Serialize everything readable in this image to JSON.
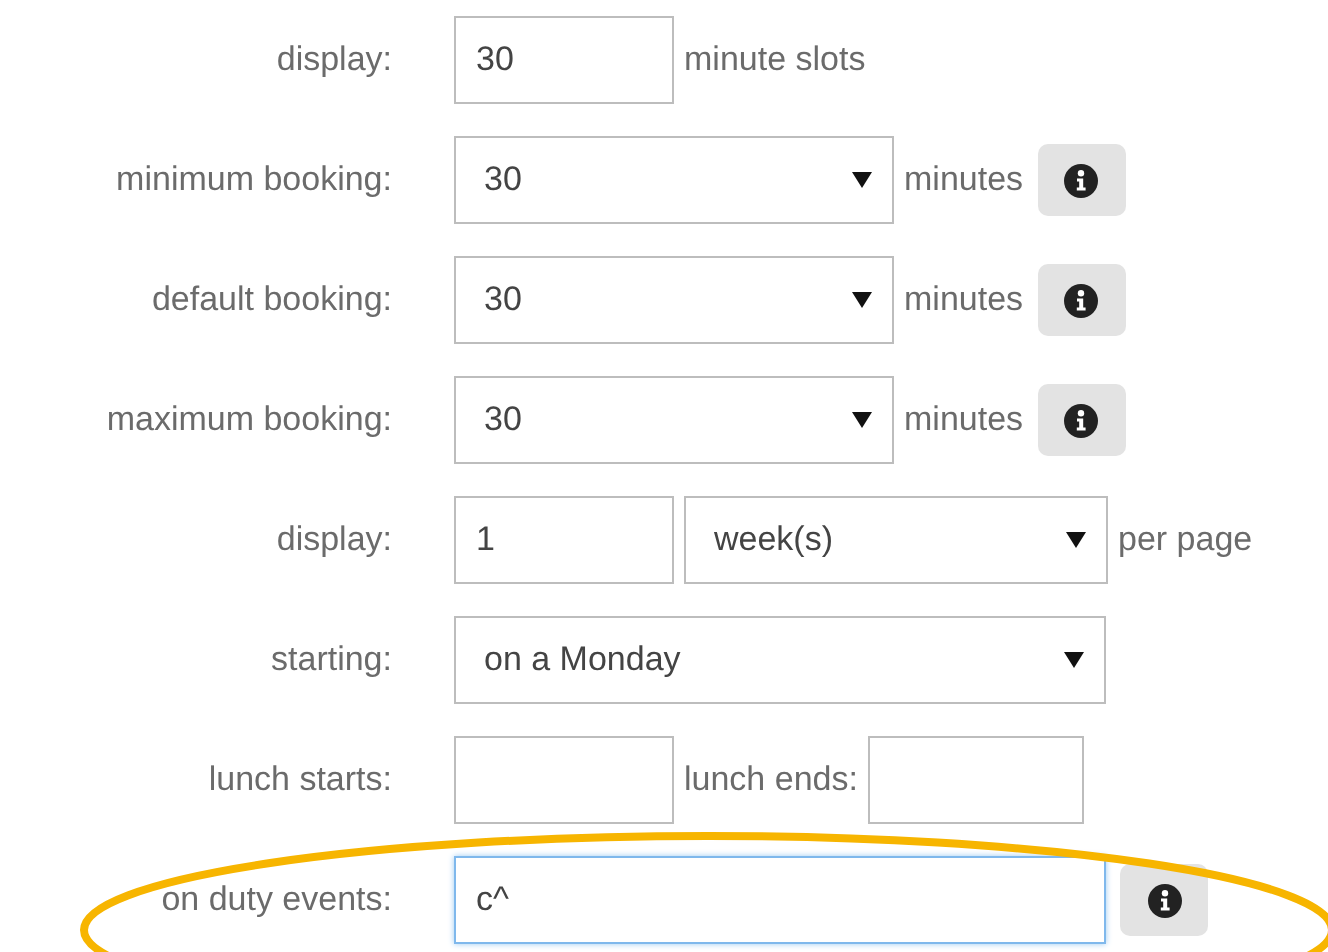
{
  "rows": [
    {
      "label": "display:",
      "circled": false,
      "controls": [
        {
          "kind": "input",
          "value": "30",
          "focused": false
        },
        {
          "kind": "text",
          "text": "minute slots"
        }
      ]
    },
    {
      "label": "minimum booking:",
      "circled": false,
      "controls": [
        {
          "kind": "select",
          "value": "30"
        },
        {
          "kind": "text",
          "text": "minutes"
        },
        {
          "kind": "info"
        }
      ]
    },
    {
      "label": "default booking:",
      "circled": false,
      "controls": [
        {
          "kind": "select",
          "value": "30"
        },
        {
          "kind": "text",
          "text": "minutes"
        },
        {
          "kind": "info"
        }
      ]
    },
    {
      "label": "maximum booking:",
      "circled": false,
      "controls": [
        {
          "kind": "select",
          "value": "30"
        },
        {
          "kind": "text",
          "text": "minutes"
        },
        {
          "kind": "info"
        }
      ]
    },
    {
      "label": "display:",
      "circled": false,
      "controls": [
        {
          "kind": "input",
          "value": "1",
          "focused": false
        },
        {
          "kind": "select",
          "value": "week(s)"
        },
        {
          "kind": "text",
          "text": "per page"
        }
      ]
    },
    {
      "label": "starting:",
      "circled": false,
      "controls": [
        {
          "kind": "select",
          "value": "on a Monday"
        }
      ]
    },
    {
      "label": "lunch starts:",
      "circled": false,
      "controls": [
        {
          "kind": "input",
          "focused": false
        },
        {
          "kind": "text",
          "text": "lunch ends:"
        },
        {
          "kind": "input",
          "focused": false
        }
      ]
    },
    {
      "label": "on duty events:",
      "circled": true,
      "controls": [
        {
          "kind": "input",
          "value": "c^",
          "focused": true
        },
        {
          "kind": "info"
        }
      ]
    }
  ]
}
